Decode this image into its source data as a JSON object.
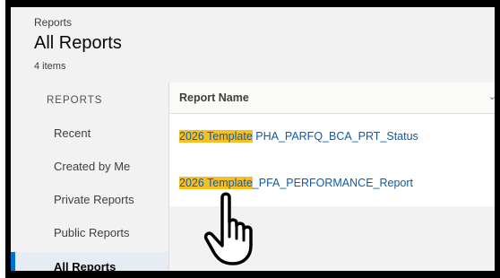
{
  "header": {
    "breadcrumb": "Reports",
    "title": "All Reports",
    "item_count": "4 items"
  },
  "sidebar": {
    "heading": "REPORTS",
    "items": [
      {
        "label": "Recent"
      },
      {
        "label": "Created by Me"
      },
      {
        "label": "Private Reports"
      },
      {
        "label": "Public Reports"
      },
      {
        "label": "All Reports",
        "active": true
      }
    ]
  },
  "table": {
    "column_header": "Report Name",
    "rows": [
      {
        "highlight": "2026 Template",
        "rest": " PHA_PARFQ_BCA_PRT_Status"
      },
      {
        "highlight": "2026 Template",
        "rest": "_PFA_PERFORMANCE_Report"
      }
    ]
  },
  "colors": {
    "accent": "#0070d2",
    "link": "#0b5cab",
    "highlight": "#f6c025"
  },
  "icons": {
    "sort": "chevron-down-icon",
    "cursor": "hand-pointer-icon"
  }
}
